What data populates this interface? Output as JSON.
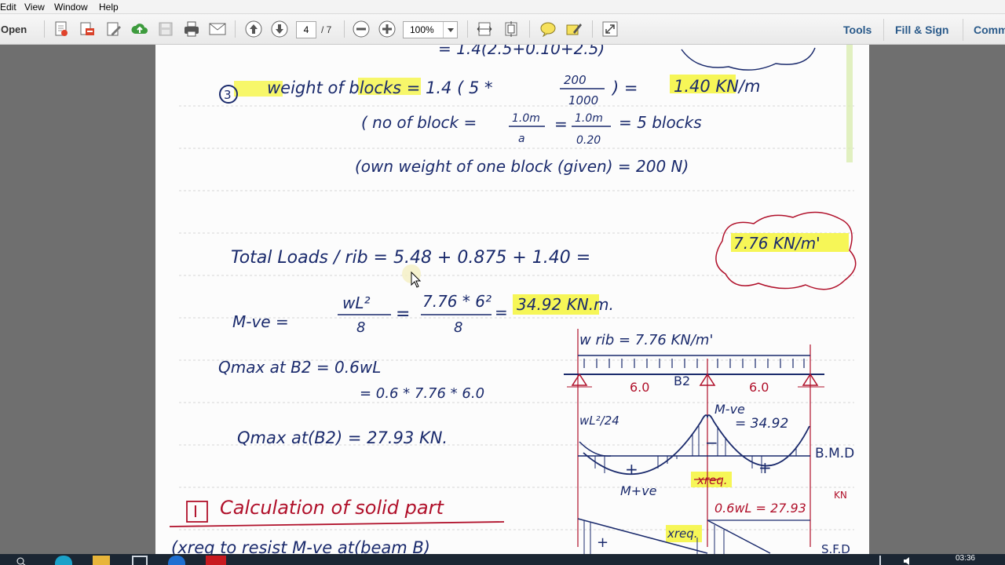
{
  "menu": {
    "items": [
      "Edit",
      "View",
      "Window",
      "Help"
    ]
  },
  "toolbar": {
    "open_label": "Open",
    "current_page": "4",
    "page_total": "/ 7",
    "zoom": "100%",
    "tools_label": "Tools",
    "fill_sign_label": "Fill & Sign",
    "comment_label": "Comm"
  },
  "document": {
    "top_partial": "= 1.4(2.5+0.10+2.5)",
    "line_3_num": "3",
    "line_3": "weight of blocks = 1.4 ( 5 * 200/1000 ) = 1.40 KN/m",
    "line_3_frac_num": "200",
    "line_3_frac_den": "1000",
    "line_3_result": "1.40 KN/m",
    "line_4_a": "( no of block =",
    "line_4_b": "1.0m",
    "line_4_c": "a",
    "line_4_d": "1.0m",
    "line_4_e": "0.20",
    "line_4_f": "= 5  blocks",
    "line_5": "(own weight of one  block (given) = 200 N)",
    "total_label": "Total Loads / rib =  5.48 + 0.875 + 1.40 =",
    "total_result": "7.76 KN/m'",
    "moment_label": "M-ve =",
    "moment_num": "wL²",
    "moment_den": "8",
    "moment_num2": "7.76 * 6²",
    "moment_den2": "8",
    "moment_result": "34.92  KN.m.",
    "qmax_1": "Qmax at  B2 = 0.6wL",
    "qmax_2": "= 0.6 * 7.76 * 6.0",
    "qmax_3": "Qmax at(B2) = 27.93  KN.",
    "section_num": "I",
    "section_title": "Calculation of solid part",
    "bottom_partial": "(xreq  to resist  M-ve at(beam B)",
    "diagram": {
      "w_label": "w rib = 7.76 KN/m'",
      "span_left": "6.0",
      "support_mid": "B2",
      "span_right": "6.0",
      "wl_label": "wL²/24",
      "mve_label": "M-ve",
      "mve_value": "= 34.92",
      "minus": "−",
      "plus_left": "+",
      "plus_right": "+",
      "bmd_label": "B.M.D",
      "mpos_label": "M+ve",
      "xreq_label": "xreq.",
      "shear_label": "0.6wL = 27.93",
      "shear_unit": "KN",
      "xreq2_label": "xreq.",
      "plus_bottom": "+",
      "sfd_label": "S.F.D"
    }
  },
  "taskbar": {
    "clock": "03:36"
  },
  "colors": {
    "ink": "#1a2a6c",
    "ink_red": "#b0102a",
    "highlight": "#f5f545",
    "doc_bg": "#6f6f6f",
    "link": "#2a5a8a"
  }
}
